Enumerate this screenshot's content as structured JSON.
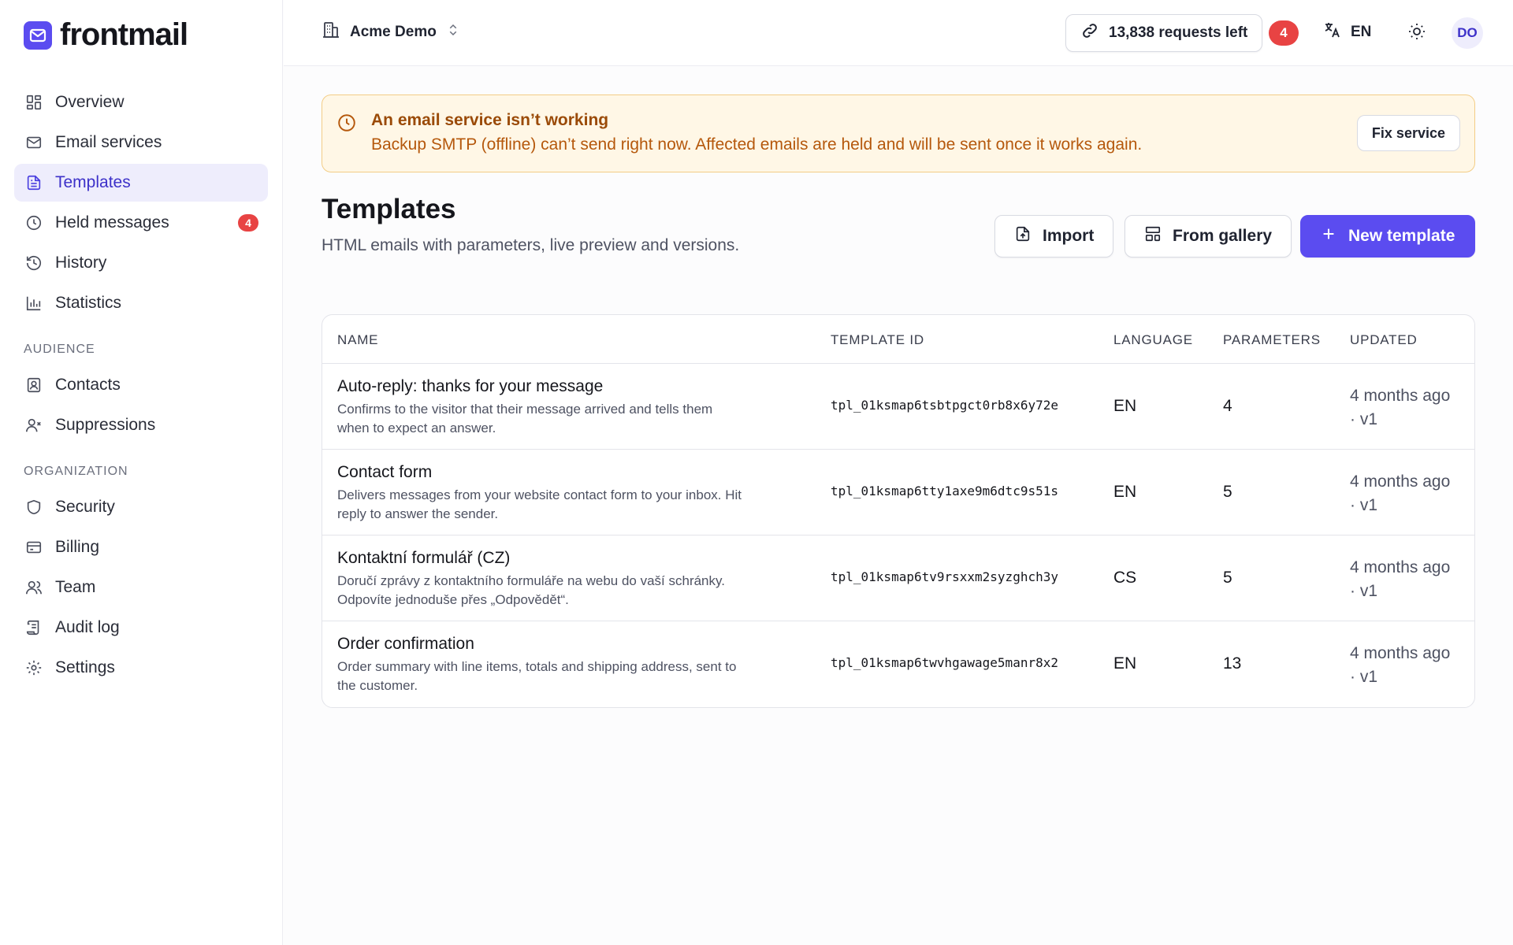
{
  "brand": {
    "name": "frontmail"
  },
  "sidebar": {
    "items": [
      {
        "label": "Overview",
        "icon": "dashboard-icon"
      },
      {
        "label": "Email services",
        "icon": "mail-icon"
      },
      {
        "label": "Templates",
        "icon": "file-text-icon",
        "active": true
      },
      {
        "label": "Held messages",
        "icon": "clock-icon",
        "badge": "4"
      },
      {
        "label": "History",
        "icon": "history-icon"
      },
      {
        "label": "Statistics",
        "icon": "bar-chart-icon"
      }
    ],
    "audience_label": "AUDIENCE",
    "audience_items": [
      {
        "label": "Contacts",
        "icon": "contact-card-icon"
      },
      {
        "label": "Suppressions",
        "icon": "user-x-icon"
      }
    ],
    "organization_label": "ORGANIZATION",
    "organization_items": [
      {
        "label": "Security",
        "icon": "shield-icon"
      },
      {
        "label": "Billing",
        "icon": "credit-card-icon"
      },
      {
        "label": "Team",
        "icon": "users-icon"
      },
      {
        "label": "Audit log",
        "icon": "scroll-icon"
      },
      {
        "label": "Settings",
        "icon": "gear-icon"
      }
    ]
  },
  "topbar": {
    "workspace": "Acme Demo",
    "requests": "13,838 requests left",
    "notifications": "4",
    "language": "EN",
    "avatar": "DO"
  },
  "alert": {
    "title": "An email service isn’t working",
    "description": "Backup SMTP (offline) can’t send right now. Affected emails are held and will be sent once it works again.",
    "action": "Fix service"
  },
  "page": {
    "title": "Templates",
    "subtitle": "HTML emails with parameters, live preview and versions.",
    "import": "Import",
    "gallery": "From gallery",
    "new": "New template"
  },
  "table": {
    "headers": {
      "name": "NAME",
      "id": "TEMPLATE ID",
      "language": "LANGUAGE",
      "parameters": "PARAMETERS",
      "updated": "UPDATED"
    },
    "rows": [
      {
        "name": "Auto-reply: thanks for your message",
        "desc_1": "Confirms to the visitor that their message arrived and tells them",
        "desc_2": "when to expect an answer.",
        "id": "tpl_01ksmap6tsbtpgct0rb8x6y72e",
        "language": "EN",
        "parameters": "4",
        "updated_1": "4 months ago",
        "updated_2": "· v1"
      },
      {
        "name": "Contact form",
        "desc_1": "Delivers messages from your website contact form to your inbox. Hit",
        "desc_2": "reply to answer the sender.",
        "id": "tpl_01ksmap6tty1axe9m6dtc9s51s",
        "language": "EN",
        "parameters": "5",
        "updated_1": "4 months ago",
        "updated_2": "· v1"
      },
      {
        "name": "Kontaktní formulář (CZ)",
        "desc_1": "Doručí zprávy z kontaktního formuláře na webu do vaší schránky.",
        "desc_2": "Odpovíte jednoduše přes „Odpovědět“.",
        "id": "tpl_01ksmap6tv9rsxxm2syzghch3y",
        "language": "CS",
        "parameters": "5",
        "updated_1": "4 months ago",
        "updated_2": "· v1"
      },
      {
        "name": "Order confirmation",
        "desc_1": "Order summary with line items, totals and shipping address, sent to",
        "desc_2": "the customer.",
        "id": "tpl_01ksmap6twvhgawage5manr8x2",
        "language": "EN",
        "parameters": "13",
        "updated_1": "4 months ago",
        "updated_2": "· v1"
      }
    ]
  },
  "colors": {
    "accent": "#5b4cf0",
    "danger": "#e84343",
    "warning_bg": "#fff7e6",
    "warning_text": "#b5580c"
  }
}
